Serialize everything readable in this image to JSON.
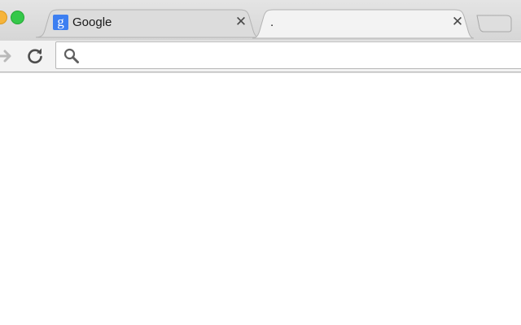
{
  "window": {
    "controls": [
      "minimize",
      "maximize"
    ]
  },
  "tabs": [
    {
      "title": "Google",
      "favicon_letter": "g",
      "favicon_icon": "google-g-icon",
      "close_glyph": "✕",
      "state": "inactive"
    },
    {
      "title": ".",
      "close_glyph": "✕",
      "state": "active"
    }
  ],
  "toolbar": {
    "forward_icon": "forward-arrow-icon",
    "reload_icon": "reload-icon"
  },
  "omnibox": {
    "icon": "search-icon",
    "value": "",
    "placeholder": ""
  },
  "colors": {
    "tab_strip": "#d6d6d6",
    "active_tab": "#f3f3f3",
    "favicon": "#3d7ff1",
    "minimize": "#f6b43a",
    "maximize": "#35c84a"
  }
}
